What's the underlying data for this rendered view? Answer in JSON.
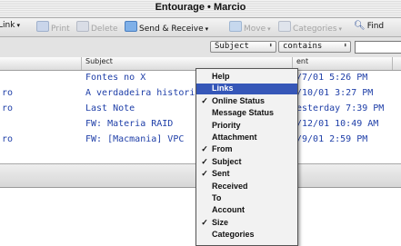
{
  "window": {
    "title": "Entourage • Marcio"
  },
  "toolbar": {
    "link": "Link",
    "print": "Print",
    "delete": "Delete",
    "send_receive": "Send & Receive",
    "move": "Move",
    "categories": "Categories",
    "find": "Find"
  },
  "filter": {
    "field": "Subject",
    "operator": "contains",
    "query": ""
  },
  "columns": {
    "subject": "Subject",
    "sent": "ent"
  },
  "messages": [
    {
      "from": "",
      "subject": "Fontes no X",
      "sent": "/7/01 5:26 PM"
    },
    {
      "from": "ro",
      "subject": "A verdadeira histori",
      "sent": "/10/01 3:27 PM"
    },
    {
      "from": "ro",
      "subject": "Last Note",
      "sent": "esterday 7:39 PM"
    },
    {
      "from": "",
      "subject": "FW: Materia RAID",
      "sent": "/12/01 10:49 AM"
    },
    {
      "from": "ro",
      "subject": "FW: [Macmania] VPC",
      "sent": "/9/01 2:59 PM"
    }
  ],
  "menu": {
    "items": [
      {
        "label": "Help",
        "checked": false,
        "selected": false
      },
      {
        "label": "Links",
        "checked": false,
        "selected": true
      },
      {
        "label": "Online Status",
        "checked": true,
        "selected": false
      },
      {
        "label": "Message Status",
        "checked": false,
        "selected": false
      },
      {
        "label": "Priority",
        "checked": false,
        "selected": false
      },
      {
        "label": "Attachment",
        "checked": false,
        "selected": false
      },
      {
        "label": "From",
        "checked": true,
        "selected": false
      },
      {
        "label": "Subject",
        "checked": true,
        "selected": false
      },
      {
        "label": "Sent",
        "checked": true,
        "selected": false
      },
      {
        "label": "Received",
        "checked": false,
        "selected": false
      },
      {
        "label": "To",
        "checked": false,
        "selected": false
      },
      {
        "label": "Account",
        "checked": false,
        "selected": false
      },
      {
        "label": "Size",
        "checked": true,
        "selected": false
      },
      {
        "label": "Categories",
        "checked": false,
        "selected": false
      }
    ]
  },
  "colors": {
    "menu_highlight": "#3657b8",
    "message_text": "#1f3fa8"
  }
}
